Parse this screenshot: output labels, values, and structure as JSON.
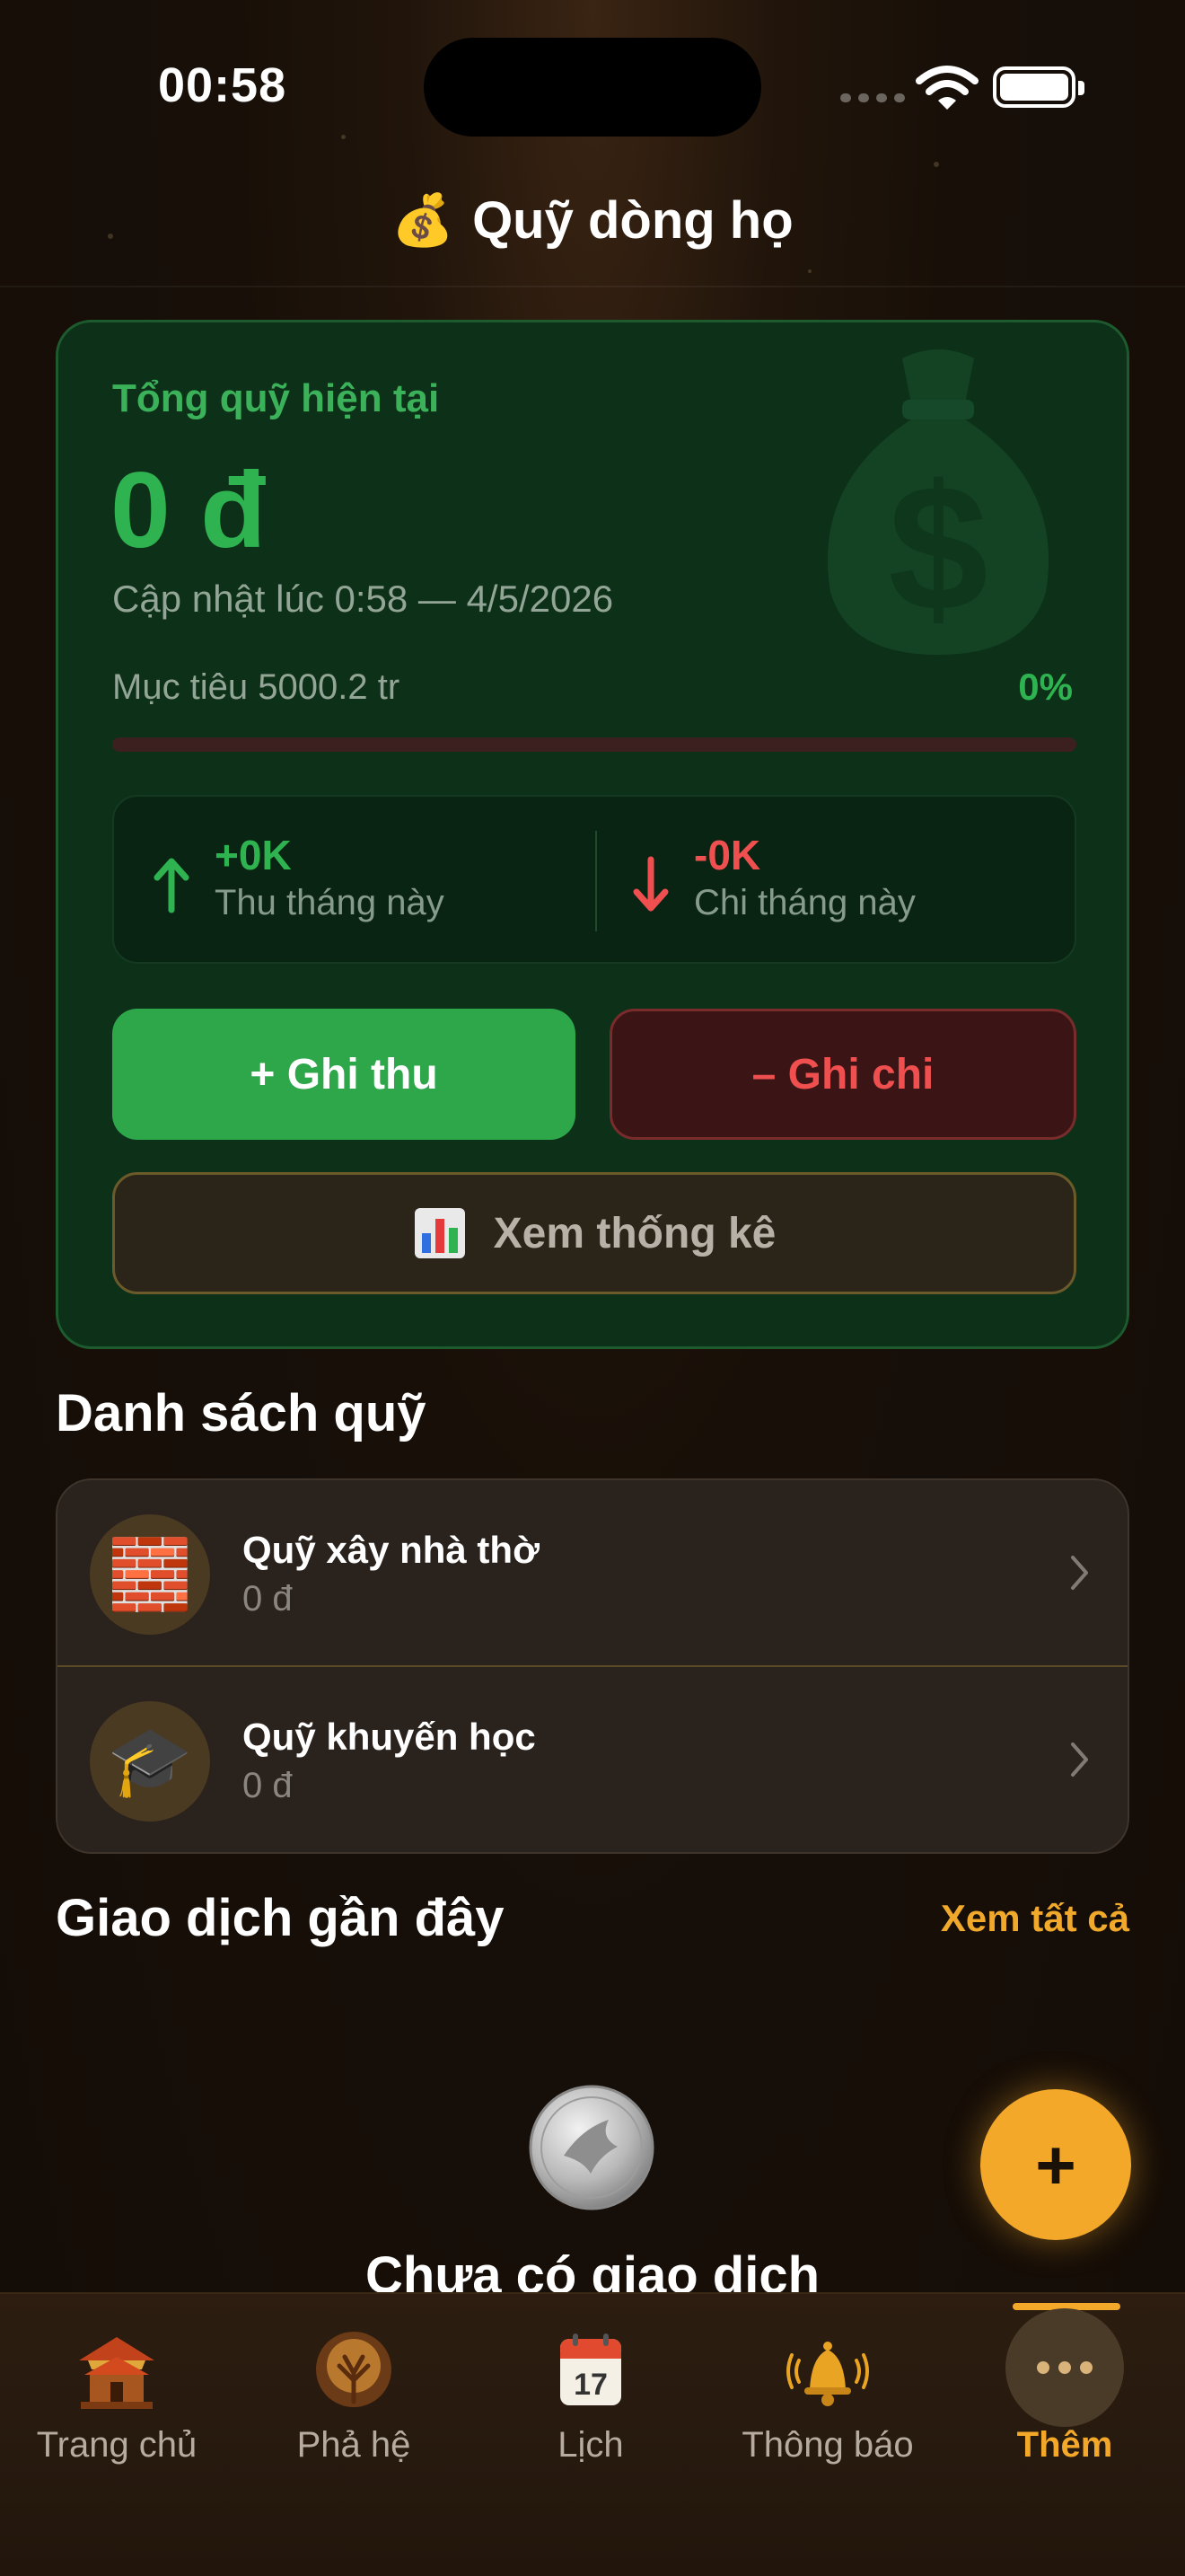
{
  "status_bar": {
    "time": "00:58"
  },
  "header": {
    "icon": "money-bag-icon",
    "emoji": "💰",
    "title": "Quỹ dòng họ"
  },
  "summary": {
    "total_label": "Tổng quỹ hiện tại",
    "total_amount": "0 đ",
    "updated": "Cập nhật lúc 0:58 — 4/5/2026",
    "goal_label": "Mục tiêu 5000.2 tr",
    "goal_percent": "0%",
    "goal_progress": 0,
    "income": {
      "amount": "+0K",
      "label": "Thu tháng này"
    },
    "expense": {
      "amount": "-0K",
      "label": "Chi tháng này"
    },
    "income_button": "+ Ghi thu",
    "expense_button": "– Ghi chi",
    "stats_button": "Xem thống kê"
  },
  "funds": {
    "title": "Danh sách quỹ",
    "items": [
      {
        "name": "Quỹ xây nhà thờ",
        "amount": "0 đ",
        "icon": "bricks-icon",
        "emoji": "🧱"
      },
      {
        "name": "Quỹ khuyến học",
        "amount": "0 đ",
        "icon": "graduation-cap-icon",
        "emoji": "🎓"
      }
    ]
  },
  "transactions": {
    "title": "Giao dịch gần đây",
    "see_all": "Xem tất cả",
    "empty_text": "Chưa có giao dịch"
  },
  "fab": {
    "label": "+"
  },
  "tabs": [
    {
      "label": "Trang chủ",
      "icon": "temple-icon"
    },
    {
      "label": "Phả hệ",
      "icon": "family-tree-icon"
    },
    {
      "label": "Lịch",
      "icon": "calendar-icon",
      "calendar_day": "17"
    },
    {
      "label": "Thông báo",
      "icon": "bell-icon"
    },
    {
      "label": "Thêm",
      "icon": "more-icon",
      "active": true
    }
  ],
  "colors": {
    "accent": "#f3a82a",
    "income_green": "#2fb351",
    "expense_red": "#ef4f4f",
    "card_green": "#0c3018"
  }
}
